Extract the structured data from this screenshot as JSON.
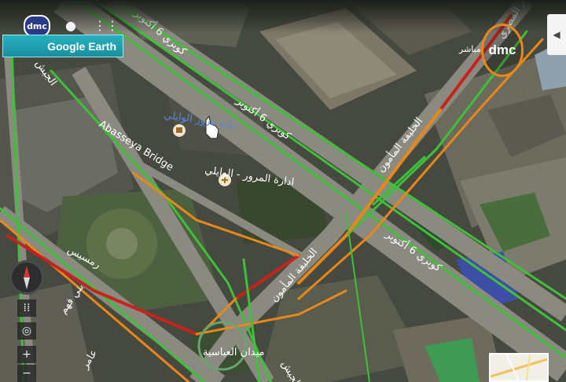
{
  "app": {
    "channel_badge": "dmc",
    "live_label": "مباشر",
    "logo_text": "dmc",
    "banner_title": "Google Earth"
  },
  "map_labels": {
    "bridge_top": "كوبري 6 أكتوبر",
    "bridge_mid": "كوبري 6 أكتوبر",
    "bridge_lower": "كوبري 6 أكتوبر",
    "abbasseya_bridge": "Abasseya Bridge",
    "traffic_building": "ادارة المرور - الوايلي",
    "traffic_building_2": "نيابة مرور الوايلي",
    "khalifa_1": "الخليفة المأمون",
    "khalifa_2": "الخليفة المأمون",
    "ramses": "رمسيس",
    "abbasseya_square": "ميدان العباسية",
    "bin_fahm": "بني فهم",
    "left_street": "الجيش",
    "road_small": "الجيش",
    "top_right_street": "عمر المصري",
    "bottom_left_street": "عامر"
  },
  "controls": {
    "collapse_icon": "chevron-left-icon",
    "zoom_in": "+",
    "zoom_out": "−",
    "grid": "⁞⁞"
  },
  "colors": {
    "traffic_green": "#3fbf3a",
    "traffic_orange": "#e8871a",
    "traffic_red": "#c8221d",
    "banner": "#1fa2b3"
  }
}
